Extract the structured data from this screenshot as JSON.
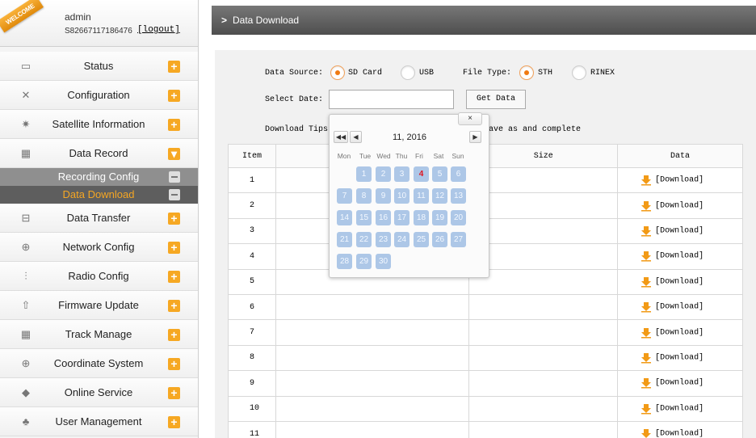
{
  "sidebar": {
    "welcome": "WELCOME",
    "user": {
      "name": "admin",
      "serial": "S82667117186476",
      "logout": "[logout]"
    },
    "menu": [
      {
        "label": "Status",
        "icon": "monitor-icon"
      },
      {
        "label": "Configuration",
        "icon": "tools-icon"
      },
      {
        "label": "Satellite Information",
        "icon": "satellite-icon"
      },
      {
        "label": "Data Record",
        "icon": "calendar-icon",
        "expanded": true,
        "sub": [
          {
            "label": "Recording Config",
            "active": false
          },
          {
            "label": "Data Download",
            "active": true
          }
        ]
      },
      {
        "label": "Data Transfer",
        "icon": "network-icon"
      },
      {
        "label": "Network Config",
        "icon": "globe-icon"
      },
      {
        "label": "Radio Config",
        "icon": "antenna-icon"
      },
      {
        "label": "Firmware Update",
        "icon": "upload-icon"
      },
      {
        "label": "Track Manage",
        "icon": "calendar-icon"
      },
      {
        "label": "Coordinate System",
        "icon": "globe-icon"
      },
      {
        "label": "Online Service",
        "icon": "service-icon"
      },
      {
        "label": "User Management",
        "icon": "users-icon"
      }
    ]
  },
  "page": {
    "title": "Data Download"
  },
  "form": {
    "data_source_label": "Data Source:",
    "sources": [
      "SD Card",
      "USB"
    ],
    "selected_source": "SD Card",
    "file_type_label": "File Type:",
    "file_types": [
      "STH",
      "RINEX"
    ],
    "selected_file_type": "STH",
    "select_date_label": "Select Date:",
    "date_value": "",
    "get_data_label": "Get Data",
    "tips_label": "Download Tips:",
    "tips_text_visible": "ave as and complete"
  },
  "table": {
    "headers": [
      "Item",
      "",
      "Size",
      "Data"
    ],
    "rows": [
      {
        "item": "1",
        "name": "",
        "size": "",
        "data": "[Download]"
      },
      {
        "item": "2",
        "name": "",
        "size": "",
        "data": "[Download]"
      },
      {
        "item": "3",
        "name": "",
        "size": "",
        "data": "[Download]"
      },
      {
        "item": "4",
        "name": "",
        "size": "",
        "data": "[Download]"
      },
      {
        "item": "5",
        "name": "",
        "size": "",
        "data": "[Download]"
      },
      {
        "item": "6",
        "name": "",
        "size": "",
        "data": "[Download]"
      },
      {
        "item": "7",
        "name": "",
        "size": "",
        "data": "[Download]"
      },
      {
        "item": "8",
        "name": "",
        "size": "",
        "data": "[Download]"
      },
      {
        "item": "9",
        "name": "",
        "size": "",
        "data": "[Download]"
      },
      {
        "item": "10",
        "name": "",
        "size": "",
        "data": "[Download]"
      },
      {
        "item": "11",
        "name": "",
        "size": "",
        "data": "[Download]"
      }
    ]
  },
  "calendar": {
    "close": "×",
    "prev_year": "◀◀",
    "prev_month": "◀",
    "next_month": "▶",
    "next_year": "▶▶",
    "month_label": "11, 2016",
    "weekdays": [
      "Mon",
      "Tue",
      "Wed",
      "Thu",
      "Fri",
      "Sat",
      "Sun"
    ],
    "first_weekday_index": 1,
    "days_in_month": 30,
    "highlighted_day": 4
  },
  "colors": {
    "accent": "#f6a823",
    "active_sub_text": "#f5a623",
    "header_bg": "#5a5a5a",
    "calendar_day": "#adc7e7",
    "today_text": "#e0141e"
  }
}
